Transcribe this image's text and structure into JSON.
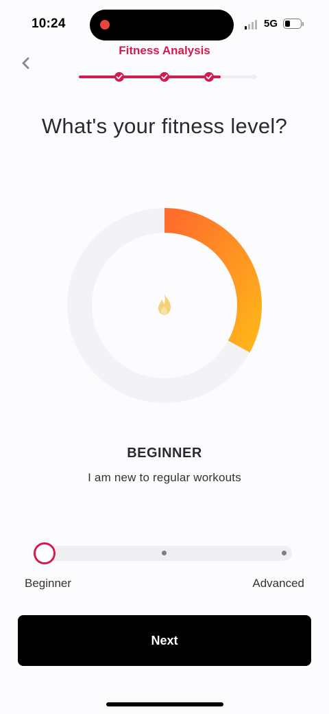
{
  "status_bar": {
    "time": "10:24",
    "network": "5G",
    "battery_level": 0.3
  },
  "header": {
    "title": "Fitness Analysis",
    "back_icon": "chevron-left-icon",
    "progress": {
      "completed_steps": 3,
      "total_steps": 5,
      "current_step_fill": 0.2
    }
  },
  "question": "What's your fitness level?",
  "gauge": {
    "fill_fraction": 0.33,
    "icon": "flame-icon",
    "gradient_start": "#ff6b2c",
    "gradient_end": "#ffb31a",
    "track_color": "#f3f3f5"
  },
  "level": {
    "name": "BEGINNER",
    "description": "I am new to regular workouts"
  },
  "slider": {
    "selected_index": 0,
    "stops": 3,
    "min_label": "Beginner",
    "max_label": "Advanced"
  },
  "next_button": {
    "label": "Next"
  },
  "colors": {
    "accent": "#d21c4e",
    "button_bg": "#000000",
    "text": "#2a2a2e"
  }
}
